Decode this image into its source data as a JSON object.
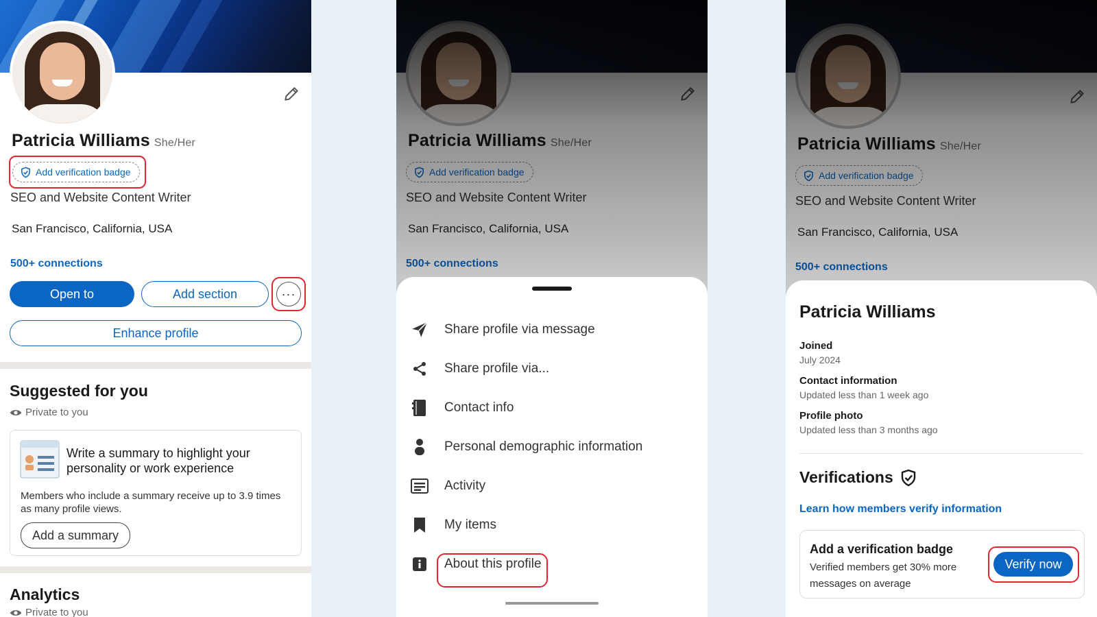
{
  "profile": {
    "name": "Patricia Williams",
    "pronouns": "She/Her",
    "verify_chip": "Add verification badge",
    "headline": "SEO and Website Content Writer",
    "location": "San Francisco, California, USA",
    "connections": "500+ connections"
  },
  "actions": {
    "open_to": "Open to",
    "add_section": "Add section",
    "more": "···",
    "enhance": "Enhance profile"
  },
  "suggested": {
    "title": "Suggested for you",
    "private": "Private to you",
    "card_title": "Write a summary to highlight your personality or work experience",
    "card_body": "Members who include a summary receive up to 3.9 times as many profile views.",
    "card_button": "Add a summary"
  },
  "analytics": {
    "title": "Analytics",
    "private": "Private to you"
  },
  "menu": {
    "items": [
      {
        "label": "Share profile via message",
        "icon": "send-icon"
      },
      {
        "label": "Share profile via...",
        "icon": "share-icon"
      },
      {
        "label": "Contact info",
        "icon": "contact-book-icon"
      },
      {
        "label": "Personal demographic information",
        "icon": "person-icon"
      },
      {
        "label": "Activity",
        "icon": "activity-icon"
      },
      {
        "label": "My items",
        "icon": "bookmark-icon"
      },
      {
        "label": "About this profile",
        "icon": "info-icon"
      }
    ]
  },
  "about": {
    "title": "Patricia Williams",
    "joined_label": "Joined",
    "joined_value": "July 2024",
    "contact_label": "Contact information",
    "contact_value": "Updated less than 1 week ago",
    "photo_label": "Profile photo",
    "photo_value": "Updated less than 3 months ago",
    "verifications_title": "Verifications",
    "learn_link": "Learn how members verify information",
    "badge_title": "Add a verification badge",
    "badge_body": "Verified members get 30% more messages on average",
    "verify_button": "Verify now"
  },
  "colors": {
    "brand": "#0a66c2",
    "highlight": "#e0252f"
  }
}
